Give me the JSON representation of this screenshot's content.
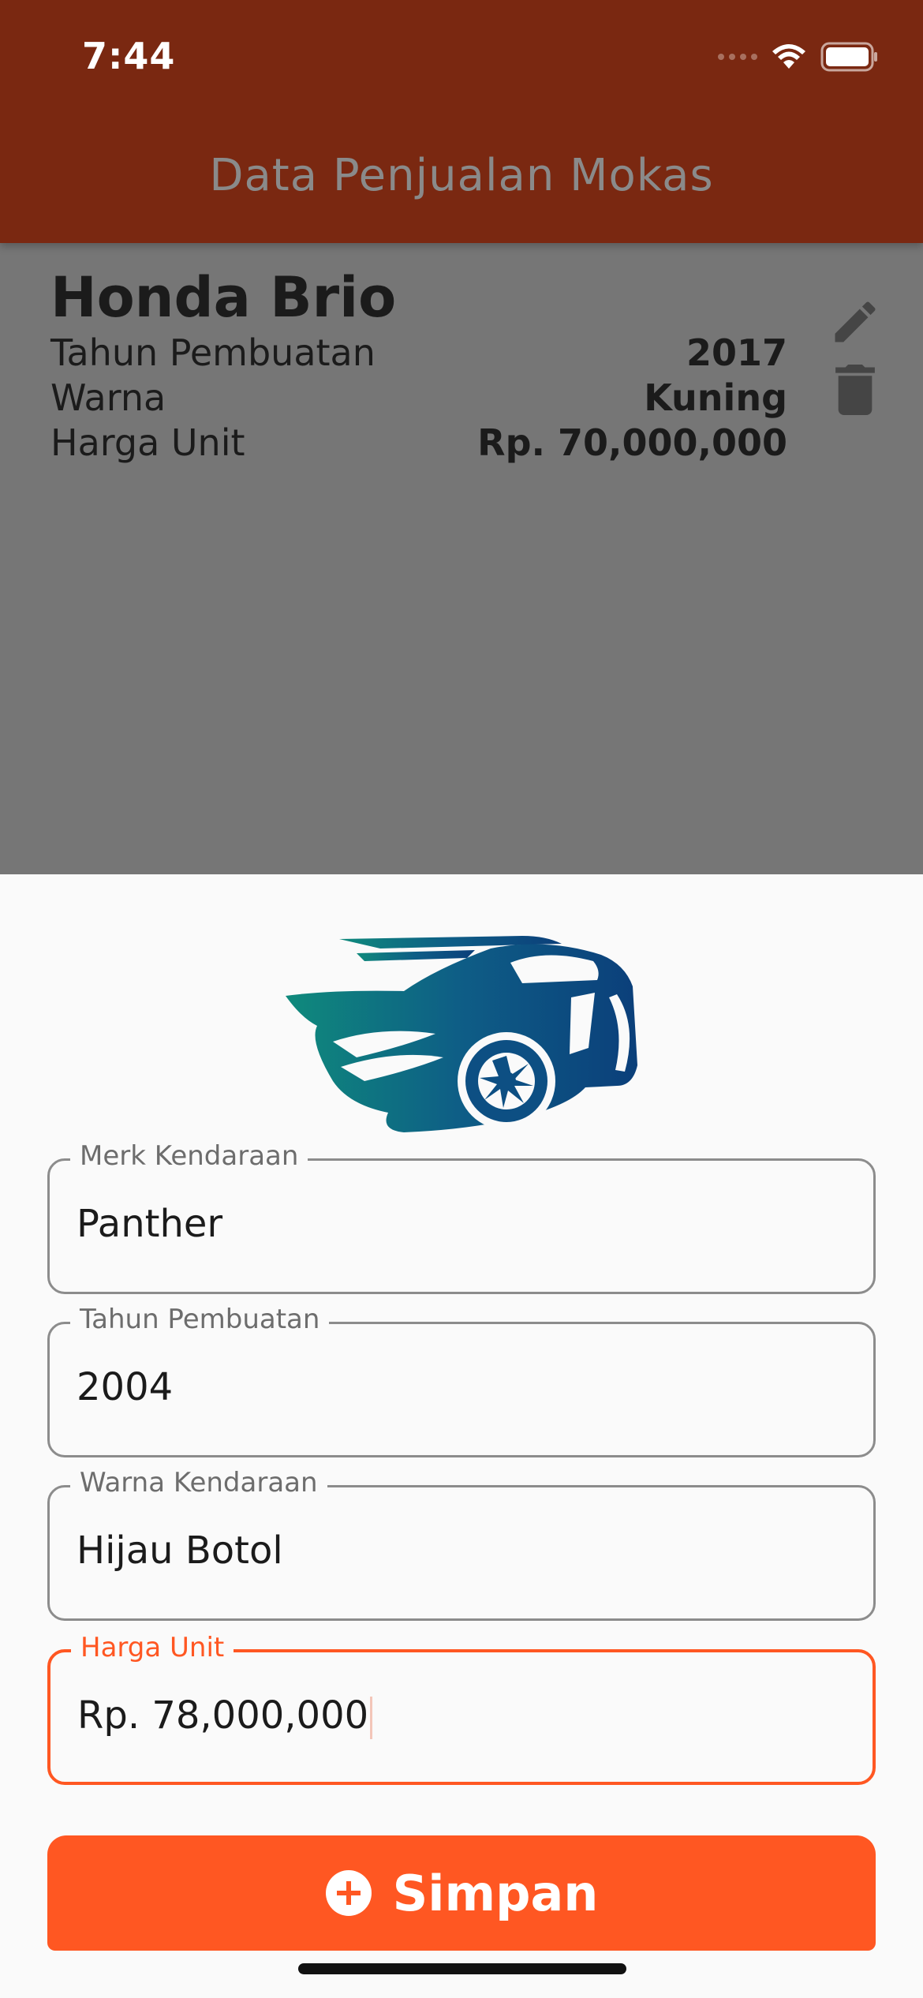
{
  "status_bar": {
    "time": "7:44"
  },
  "app_bar": {
    "title": "Data Penjualan Mokas"
  },
  "list": {
    "items": [
      {
        "name": "Honda Brio",
        "rows": [
          {
            "label": "Tahun Pembuatan",
            "value": "2017"
          },
          {
            "label": "Warna",
            "value": "Kuning"
          },
          {
            "label": "Harga Unit",
            "value": "Rp. 70,000,000"
          }
        ]
      }
    ]
  },
  "form": {
    "fields": [
      {
        "label": "Merk Kendaraan",
        "value": "Panther"
      },
      {
        "label": "Tahun Pembuatan",
        "value": "2004"
      },
      {
        "label": "Warna Kendaraan",
        "value": "Hijau Botol"
      },
      {
        "label": "Harga Unit",
        "value": "Rp. 78,000,000",
        "focused": true
      }
    ],
    "submit_label": "Simpan"
  },
  "icons": {
    "edit": "pencil-icon",
    "delete": "trash-icon",
    "submit": "add-circle-icon",
    "logo": "sports-car-logo"
  },
  "colors": {
    "app_bar": "#7a2811",
    "accent": "#ff5722",
    "scrim_background": "#767676",
    "sheet_background": "#fafafa"
  }
}
